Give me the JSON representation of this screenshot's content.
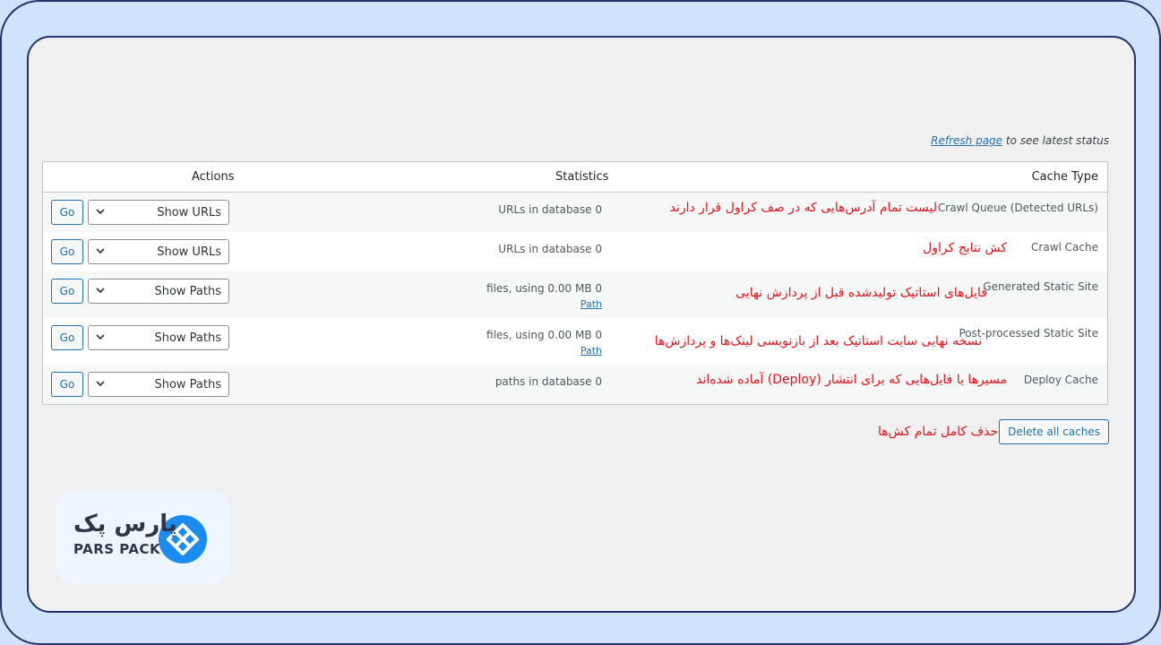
{
  "status_bar": {
    "refresh_link": "Refresh page",
    "refresh_suffix": " to see latest status"
  },
  "table": {
    "headers": {
      "cache_type": "Cache Type",
      "statistics": "Statistics",
      "actions": "Actions"
    },
    "rows": [
      {
        "cache_type": "Crawl Queue (Detected URLs)",
        "stats": "URLs in database 0",
        "path_link": "",
        "annotation": "لیست تمام آدرس‌هایی که در صف کراول قرار دارند",
        "go_label": "Go",
        "select_label": "Show URLs"
      },
      {
        "cache_type": "Crawl Cache",
        "stats": "URLs in database 0",
        "path_link": "",
        "annotation": "کش نتایج کراول",
        "go_label": "Go",
        "select_label": "Show URLs"
      },
      {
        "cache_type": "Generated Static Site",
        "stats": "files, using 0.00 MB 0",
        "path_link": "Path",
        "annotation": "فایل‌های استاتیک تولیدشده قبل از پردازش نهایی",
        "go_label": "Go",
        "select_label": "Show Paths"
      },
      {
        "cache_type": "Post-processed Static Site",
        "stats": "files, using 0.00 MB 0",
        "path_link": "Path",
        "annotation": "نسخه نهایی سایت استاتیک بعد از بازنویسی لینک‌ها و پردازش‌ها",
        "go_label": "Go",
        "select_label": "Show Paths"
      },
      {
        "cache_type": "Deploy Cache",
        "stats": "paths in database 0",
        "path_link": "",
        "annotation": "مسیرها یا فایل‌هایی که برای انتشار (Deploy) آماده شده‌اند",
        "go_label": "Go",
        "select_label": "Show Paths"
      }
    ]
  },
  "delete_button": "Delete all caches",
  "delete_annotation": "حذف کامل تمام کش‌ها",
  "logo": {
    "text_fa": "پارس پک",
    "text_en": "PARS PACK",
    "icon": "parspack-logo-icon",
    "color": "#1a8cf0"
  },
  "colors": {
    "accent": "#2271b1",
    "annotation": "#e4131b",
    "frame": "#27306e",
    "background": "#cfe3fb"
  }
}
